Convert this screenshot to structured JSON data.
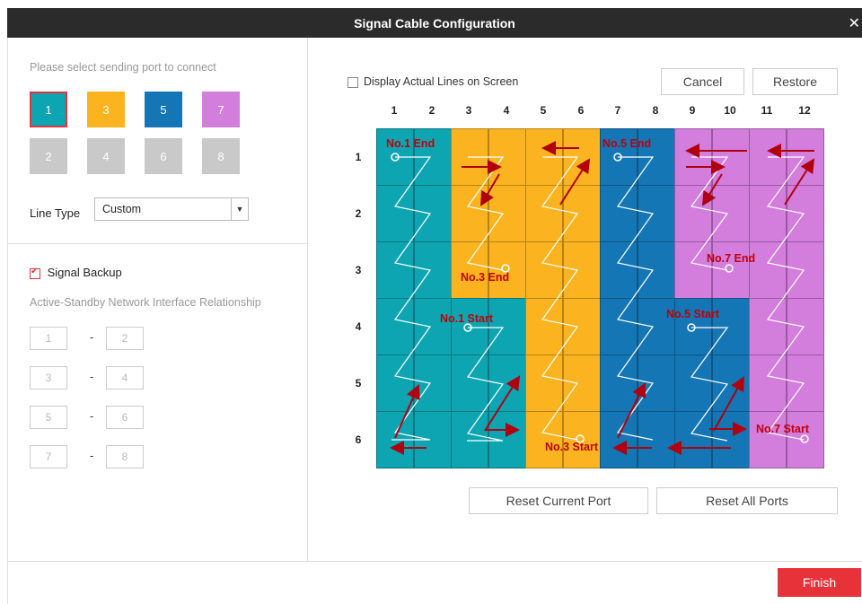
{
  "window": {
    "title": "Signal Cable Configuration",
    "close_icon": "close-icon"
  },
  "left": {
    "hint": "Please select sending port to connect",
    "ports": [
      {
        "label": "1",
        "color": "#0ea5b2",
        "active": true
      },
      {
        "label": "3",
        "color": "#fbb41f",
        "active": false
      },
      {
        "label": "5",
        "color": "#1476b4",
        "active": false
      },
      {
        "label": "7",
        "color": "#d37ddc",
        "active": false
      },
      {
        "label": "2",
        "color": "#c9c9c9",
        "active": false
      },
      {
        "label": "4",
        "color": "#c9c9c9",
        "active": false
      },
      {
        "label": "6",
        "color": "#c9c9c9",
        "active": false
      },
      {
        "label": "8",
        "color": "#c9c9c9",
        "active": false
      }
    ],
    "line_type_label": "Line Type",
    "line_type_value": "Custom",
    "signal_backup": {
      "label": "Signal Backup",
      "checked": true
    },
    "relationship_label": "Active-Standby Network Interface Relationship",
    "pairs": [
      {
        "a": "1",
        "b": "2"
      },
      {
        "a": "3",
        "b": "4"
      },
      {
        "a": "5",
        "b": "6"
      },
      {
        "a": "7",
        "b": "8"
      }
    ],
    "dash": "-"
  },
  "right": {
    "display_lines_label": "Display Actual Lines on Screen",
    "cancel_label": "Cancel",
    "restore_label": "Restore",
    "columns": [
      "1",
      "2",
      "3",
      "4",
      "5",
      "6",
      "7",
      "8",
      "9",
      "10",
      "11",
      "12"
    ],
    "rows": [
      "1",
      "2",
      "3",
      "4",
      "5",
      "6"
    ],
    "labels": {
      "no1_end": "No.1 End",
      "no1_start": "No.1 Start",
      "no3_end": "No.3 End",
      "no3_start": "No.3 Start",
      "no5_end": "No.5 End",
      "no5_start": "No.5 Start",
      "no7_end": "No.7 End",
      "no7_start": "No.7 Start"
    },
    "reset_current_label": "Reset Current Port",
    "reset_all_label": "Reset All Ports"
  },
  "footer": {
    "finish_label": "Finish"
  },
  "colors": {
    "teal": "#0ea5b2",
    "yellow": "#fbb41f",
    "blue": "#1476b4",
    "purple": "#d37ddc",
    "accent": "#e8323a",
    "arrow": "#b00010"
  }
}
